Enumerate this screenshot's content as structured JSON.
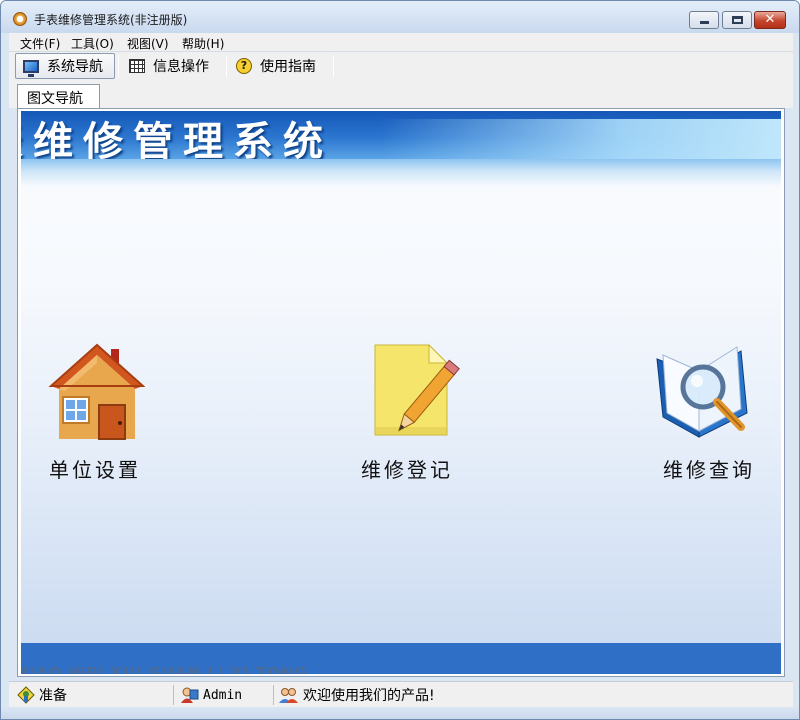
{
  "window": {
    "title": "手表维修管理系统(非注册版)"
  },
  "menubar": {
    "items": [
      "文件(F)",
      "工具(O)",
      "视图(V)",
      "帮助(H)"
    ]
  },
  "toolbar": {
    "buttons": [
      {
        "label": "系统导航",
        "icon": "monitor-icon",
        "active": true
      },
      {
        "label": "信息操作",
        "icon": "grid-icon",
        "active": false
      },
      {
        "label": "使用指南",
        "icon": "help-icon",
        "active": false
      }
    ]
  },
  "tabs": [
    {
      "label": "图文导航",
      "selected": true
    }
  ],
  "banner": {
    "title": "表维修管理系统",
    "pinyin": "BIAO WEI XIU GUAN LI XI TONG"
  },
  "features": [
    {
      "label": "单位设置",
      "icon": "house-icon"
    },
    {
      "label": "维修登记",
      "icon": "notepad-pencil-icon"
    },
    {
      "label": "维修查询",
      "icon": "book-magnifier-icon"
    }
  ],
  "statusbar": {
    "status": "准备",
    "user": "Admin",
    "message": "欢迎使用我们的产品!"
  },
  "colors": {
    "banner_blue": "#1557b7",
    "footer_blue": "#2f6fc6",
    "close_red": "#c7452d"
  }
}
